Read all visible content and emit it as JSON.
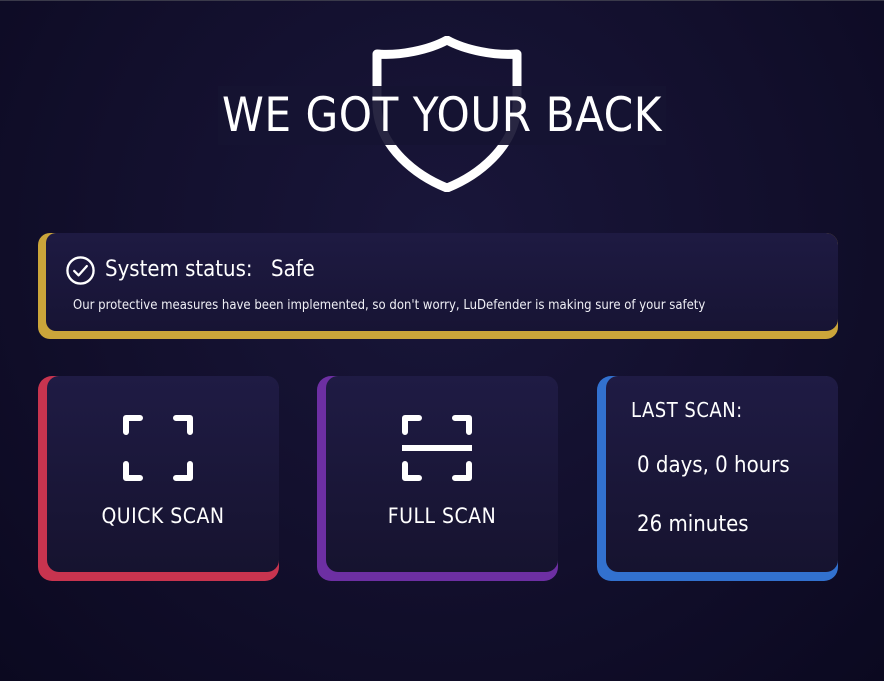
{
  "header": {
    "title": "WE GOT YOUR BACK",
    "icon": "shield-icon"
  },
  "status": {
    "label": "System status:",
    "value": "Safe",
    "description": "Our protective measures have been implemented, so don't worry, LuDefender is making sure of your safety",
    "icon": "check-circle-icon",
    "accent_color": "#cba53a"
  },
  "actions": {
    "quick_scan": {
      "label": "QUICK SCAN",
      "icon": "scan-frame-icon",
      "accent_color": "#c8344f"
    },
    "full_scan": {
      "label": "FULL SCAN",
      "icon": "scan-frame-line-icon",
      "accent_color": "#6d2fa3"
    }
  },
  "last_scan": {
    "title": "LAST SCAN:",
    "line1": "0 days, 0 hours",
    "line2": "26 minutes",
    "accent_color": "#3271cf"
  }
}
